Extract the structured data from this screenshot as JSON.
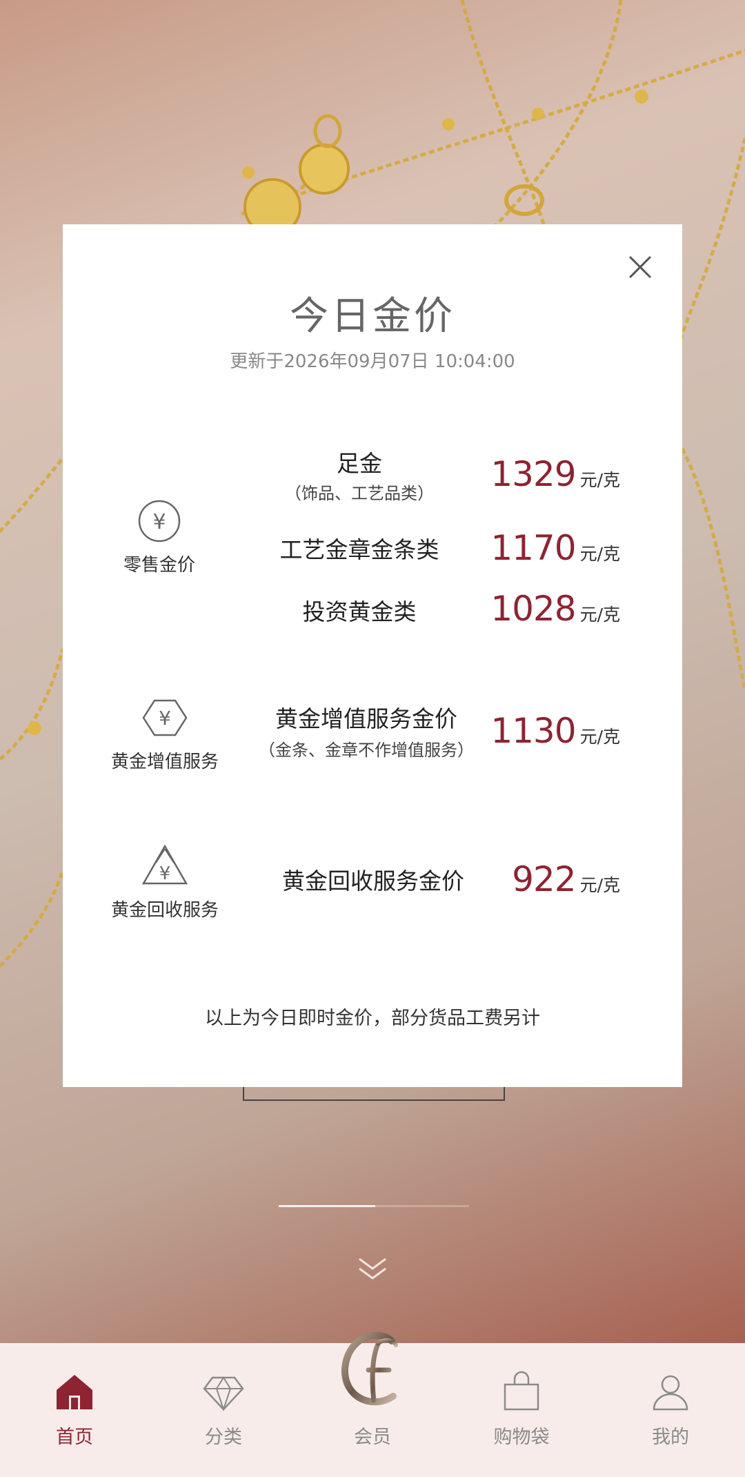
{
  "modal": {
    "title": "今日金价",
    "updated": "更新于2026年09月07日 10:04:00",
    "footnote": "以上为今日即时金价，部分货品工费另计",
    "unit": "元/克",
    "categories": [
      {
        "label": "零售金价",
        "icon": "yuan-circle-icon"
      },
      {
        "label": "黄金增值服务",
        "icon": "yuan-diamond-icon"
      },
      {
        "label": "黄金回收服务",
        "icon": "yuan-recycle-icon"
      }
    ],
    "rows": [
      {
        "name": "足金",
        "sub": "（饰品、工艺品类）",
        "price": "1329"
      },
      {
        "name": "工艺金章金条类",
        "price": "1170"
      },
      {
        "name": "投资黄金类",
        "price": "1028"
      },
      {
        "name": "黄金增值服务金价",
        "sub": "（金条、金章不作增值服务）",
        "price": "1130"
      },
      {
        "name": "黄金回收服务金价",
        "price": "922"
      }
    ]
  },
  "tabbar": {
    "items": [
      {
        "label": "首页",
        "icon": "home-icon",
        "active": true
      },
      {
        "label": "分类",
        "icon": "diamond-icon"
      },
      {
        "label": "会员",
        "icon": "member-logo-icon"
      },
      {
        "label": "购物袋",
        "icon": "shopping-bag-icon"
      },
      {
        "label": "我的",
        "icon": "person-icon"
      }
    ]
  },
  "colors": {
    "accent": "#8e2332",
    "tabbar_bg": "#f7ecea"
  }
}
